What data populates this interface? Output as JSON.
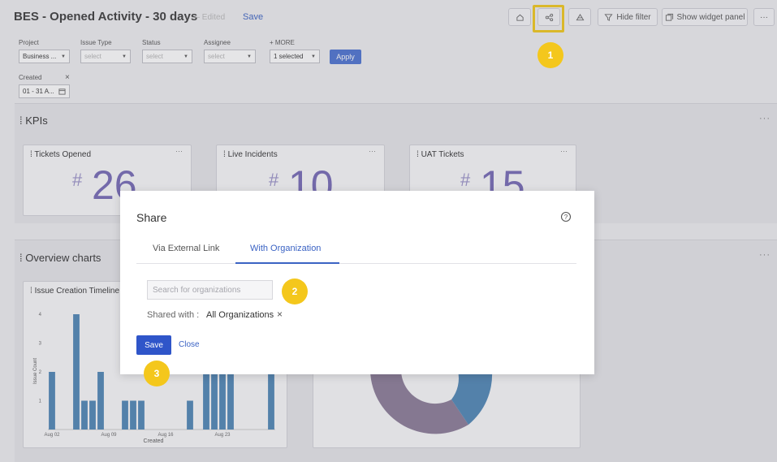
{
  "header": {
    "title": "BES - Opened Activity - 30 days",
    "edited": "— Edited",
    "save_label": "Save",
    "hide_filter": "Hide filter",
    "show_widget_panel": "Show widget panel",
    "more": "···"
  },
  "filters": {
    "project": {
      "label": "Project",
      "value": "Business ..."
    },
    "issue_type": {
      "label": "Issue Type",
      "placeholder": "select"
    },
    "status": {
      "label": "Status",
      "placeholder": "select"
    },
    "assignee": {
      "label": "Assignee",
      "placeholder": "select"
    },
    "more": {
      "label": "+ MORE",
      "value": "1 selected"
    },
    "apply_label": "Apply",
    "created": {
      "label": "Created",
      "value": "01 - 31 A...",
      "close": "×"
    }
  },
  "kpis_panel": {
    "title": "KPIs",
    "more": "···",
    "cards": [
      {
        "title": "Tickets Opened",
        "hash": "#",
        "value": "26"
      },
      {
        "title": "Live Incidents",
        "hash": "#",
        "value": "10"
      },
      {
        "title": "UAT Tickets",
        "hash": "#",
        "value": "15"
      }
    ]
  },
  "overview_panel": {
    "title": "Overview charts",
    "more": "···",
    "timeline_title": "Issue Creation Timeline"
  },
  "chart_data": {
    "type": "bar",
    "title": "Issue Creation Timeline",
    "xlabel": "Created",
    "ylabel": "Issue Count",
    "ylim": [
      0,
      4
    ],
    "yticks": [
      "1",
      "2",
      "3",
      "4"
    ],
    "xticks": [
      "Aug 02",
      "Aug 09",
      "Aug 16",
      "Aug 23"
    ],
    "values": [
      2,
      0,
      0,
      4,
      1,
      1,
      2,
      0,
      0,
      1,
      1,
      1,
      0,
      0,
      0,
      0,
      0,
      1,
      0,
      2,
      2,
      2,
      2,
      0,
      0,
      0,
      0,
      2
    ],
    "color": "#4e86b5"
  },
  "modal": {
    "title": "Share",
    "tabs": [
      {
        "label": "Via External Link"
      },
      {
        "label": "With Organization"
      }
    ],
    "search_placeholder": "Search for organizations",
    "shared_with_label": "Shared with :",
    "shared_with_value": "All Organizations",
    "remove": "×",
    "save_label": "Save",
    "close_label": "Close"
  },
  "markers": [
    "1",
    "2",
    "3"
  ],
  "colors": {
    "accent": "#2f55c9",
    "marker": "#f4c71c",
    "kpi": "#7468b5"
  }
}
